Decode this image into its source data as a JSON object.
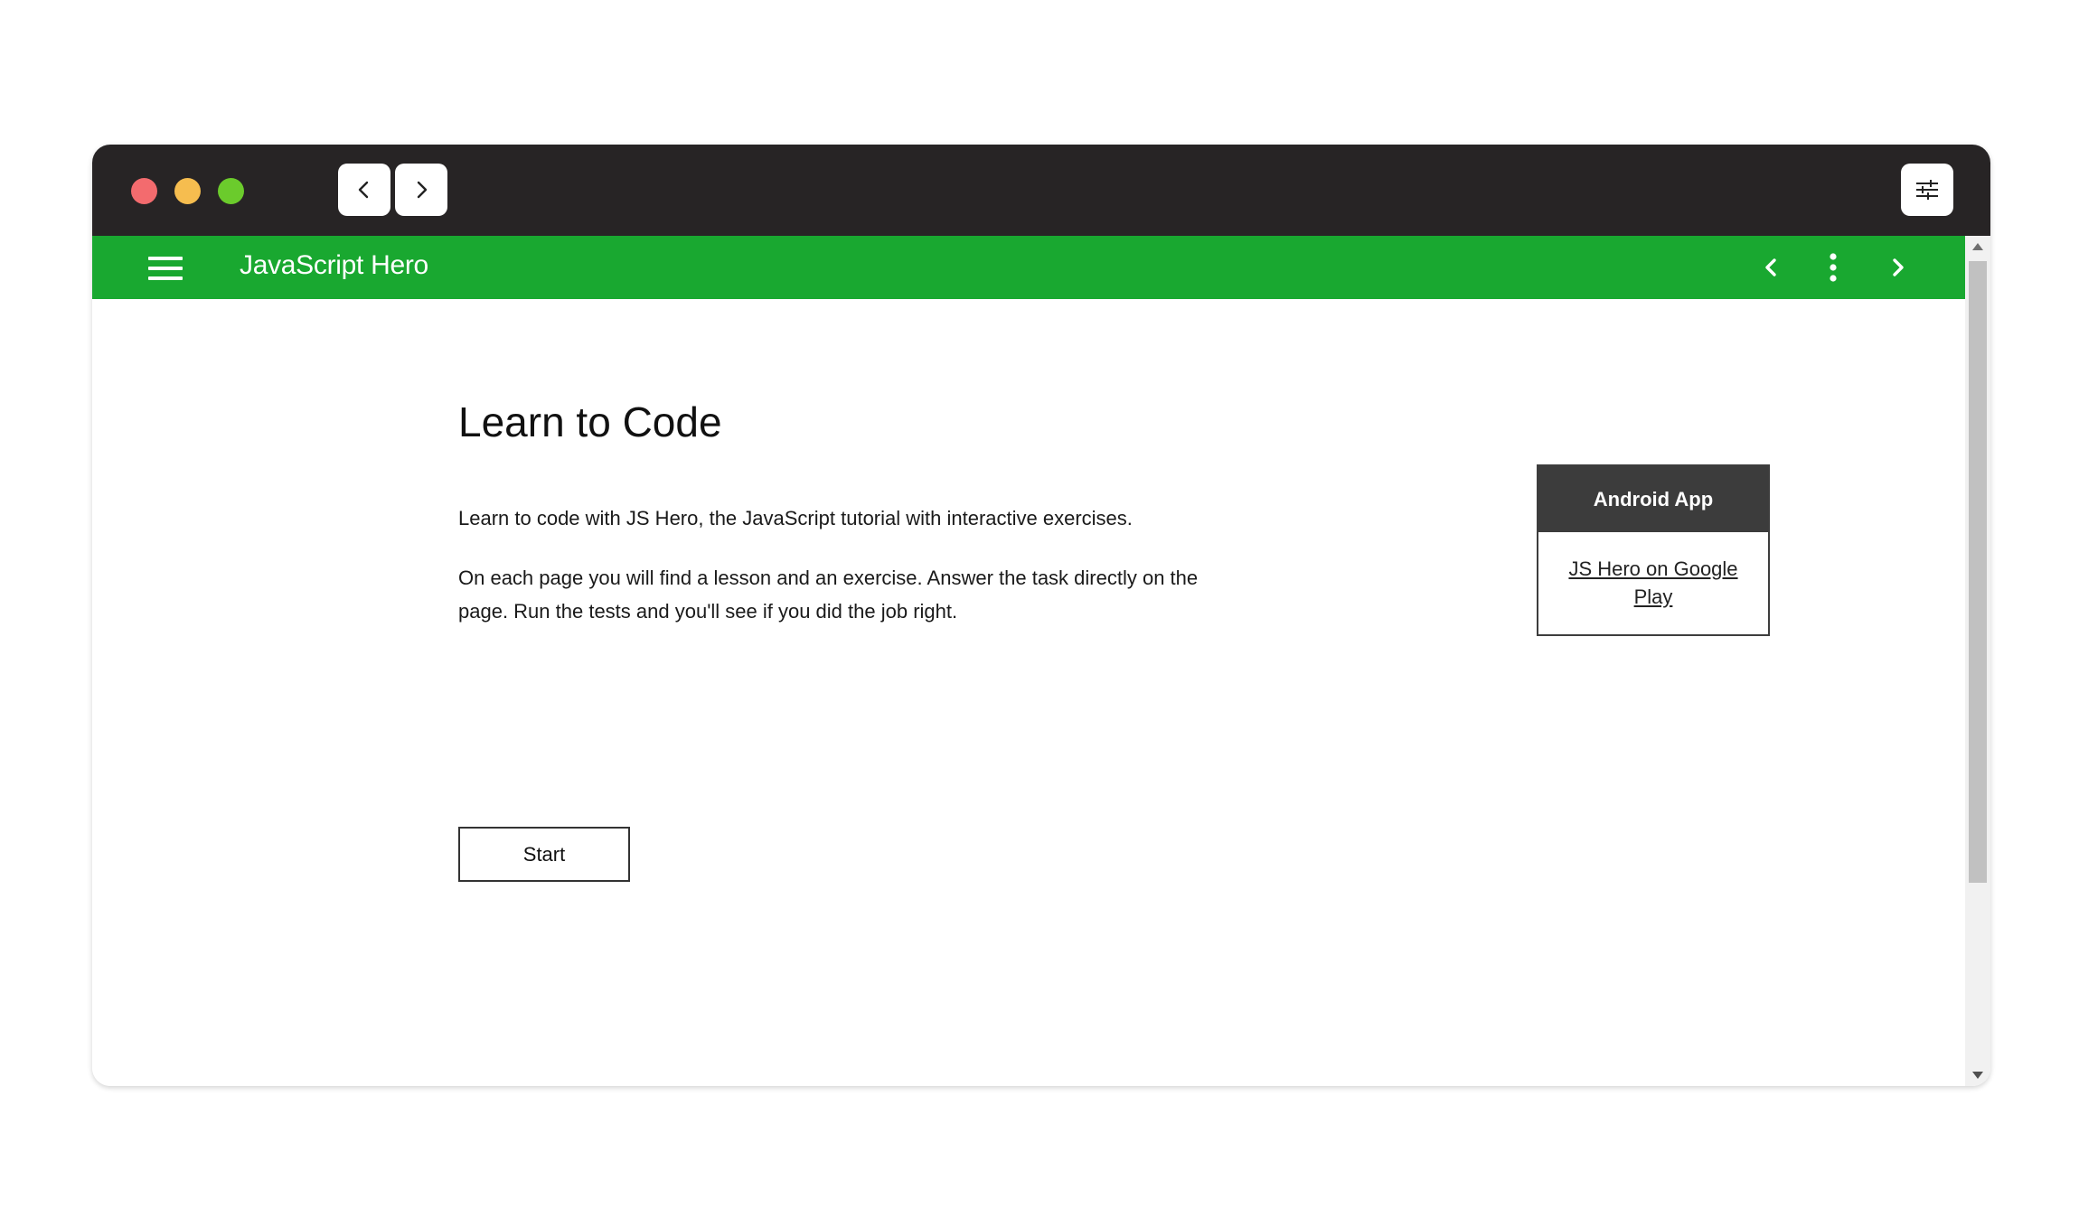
{
  "app": {
    "title": "JavaScript Hero"
  },
  "main": {
    "heading": "Learn to Code",
    "intro": "Learn to code with JS Hero, the JavaScript tutorial with interactive exercises.",
    "description": "On each page you will find a lesson and an exercise. Answer the task directly on the page. Run the tests and you'll see if you did the job right.",
    "start_label": "Start"
  },
  "sidebar": {
    "header": "Android App",
    "link_text": "JS Hero on Google Play"
  },
  "colors": {
    "titlebar": "#272425",
    "appbar": "#19a830",
    "android_header": "#3c3c3c",
    "traffic_red": "#f36b6e",
    "traffic_yellow": "#f6bd4f",
    "traffic_green": "#6bcb2c"
  },
  "icons": {
    "browser_back": "chevron-left-icon",
    "browser_forward": "chevron-right-icon",
    "browser_settings": "sliders-icon",
    "menu": "hamburger-menu-icon",
    "prev": "chevron-left-icon",
    "more": "more-vertical-icon",
    "next": "chevron-right-icon"
  }
}
